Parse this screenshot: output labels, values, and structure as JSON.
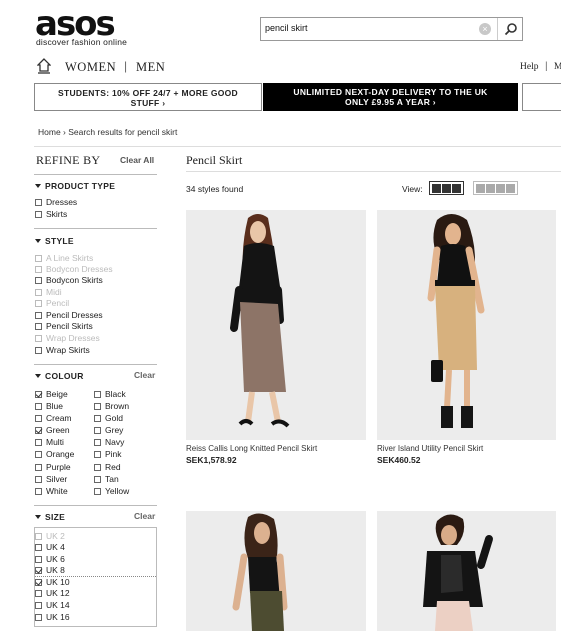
{
  "header": {
    "logo": "asos",
    "tagline": "discover fashion online",
    "search_value": "pencil skirt"
  },
  "nav": {
    "women": "WOMEN",
    "men": "MEN",
    "sep": "|",
    "help": "Help",
    "help_sep": "|",
    "more": "M"
  },
  "promos": {
    "students_line1": "STUDENTS: 10% OFF 24/7 + MORE GOOD",
    "students_line2": "STUFF ›",
    "delivery_line1": "UNLIMITED NEXT-DAY DELIVERY TO THE UK",
    "delivery_line2": "ONLY £9.95 A YEAR ›"
  },
  "breadcrumb": "Home ›  Search results for pencil skirt",
  "sidebar": {
    "refine": "REFINE BY",
    "clear_all": "Clear All",
    "product_type": {
      "title": "PRODUCT TYPE",
      "options": [
        "Dresses",
        "Skirts"
      ]
    },
    "style": {
      "title": "STYLE",
      "options": [
        "A Line Skirts",
        "Bodycon Dresses",
        "Bodycon Skirts",
        "Midi",
        "Pencil",
        "Pencil Dresses",
        "Pencil Skirts",
        "Wrap Dresses",
        "Wrap Skirts"
      ]
    },
    "colour": {
      "title": "COLOUR",
      "clear": "Clear",
      "col1": [
        "Beige",
        "Blue",
        "Cream",
        "Green",
        "Multi",
        "Orange",
        "Purple",
        "Silver",
        "White"
      ],
      "col2": [
        "Black",
        "Brown",
        "Gold",
        "Grey",
        "Navy",
        "Pink",
        "Red",
        "Tan",
        "Yellow"
      ]
    },
    "size": {
      "title": "SIZE",
      "clear": "Clear",
      "options": [
        "UK 2",
        "UK 4",
        "UK 6",
        "UK 8",
        "UK 10",
        "UK 12",
        "UK 14",
        "UK 16"
      ]
    }
  },
  "main": {
    "title": "Pencil Skirt",
    "count": "34 styles found",
    "view_label": "View:",
    "products": [
      {
        "name": "Reiss Callis Long Knitted Pencil Skirt",
        "price": "SEK1,578.92"
      },
      {
        "name": "River Island Utility Pencil Skirt",
        "price": "SEK460.52"
      }
    ]
  },
  "colors": {
    "promo_dark": "#000000",
    "card_bg": "#ececec"
  }
}
